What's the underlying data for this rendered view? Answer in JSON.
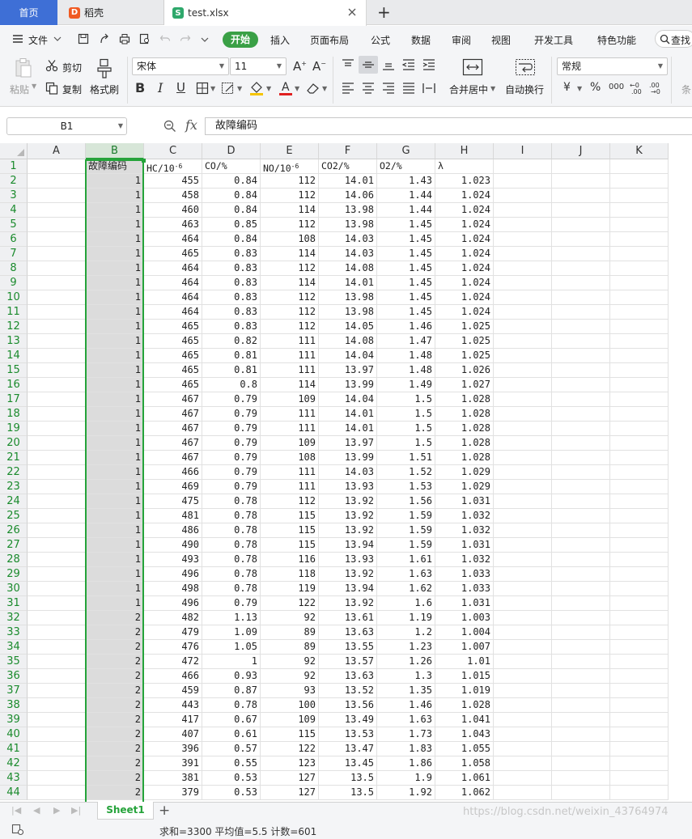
{
  "tabs": {
    "home": "首页",
    "daoke": "稻壳",
    "file": "test.xlsx",
    "add": "+"
  },
  "menu": {
    "file": "文件",
    "start": "开始",
    "insert": "插入",
    "page_layout": "页面布局",
    "formula": "公式",
    "data": "数据",
    "review": "审阅",
    "view": "视图",
    "developer": "开发工具",
    "special": "特色功能",
    "search": "查找"
  },
  "ribbon": {
    "paste": "粘贴",
    "cut": "剪切",
    "copy": "复制",
    "format_painter": "格式刷",
    "font_name": "宋体",
    "font_size": "11",
    "bold": "B",
    "italic": "I",
    "underline": "U",
    "merge_center": "合并居中",
    "wrap_text": "自动换行",
    "number_format": "常规",
    "currency": "¥",
    "percent": "%",
    "thousands": "000",
    "conditional": "条"
  },
  "formula_bar": {
    "name_box": "B1",
    "fx": "fx",
    "content": "故障编码"
  },
  "grid": {
    "columns": [
      "A",
      "B",
      "C",
      "D",
      "E",
      "F",
      "G",
      "H",
      "I",
      "J",
      "K"
    ],
    "selected_column": "B",
    "header_row": {
      "B": "故障编码",
      "C_base": "HC/10",
      "C_exp": "-6",
      "D": "CO/%",
      "E_base": "NO/10",
      "E_exp": "-6",
      "F": "CO2/%",
      "G": "O2/%",
      "H": "λ"
    },
    "rows": [
      [
        1,
        455,
        0.84,
        112,
        14.01,
        1.43,
        1.023
      ],
      [
        1,
        458,
        0.84,
        112,
        14.06,
        1.44,
        1.024
      ],
      [
        1,
        460,
        0.84,
        114,
        13.98,
        1.44,
        1.024
      ],
      [
        1,
        463,
        0.85,
        112,
        13.98,
        1.45,
        1.024
      ],
      [
        1,
        464,
        0.84,
        108,
        14.03,
        1.45,
        1.024
      ],
      [
        1,
        465,
        0.83,
        114,
        14.03,
        1.45,
        1.024
      ],
      [
        1,
        464,
        0.83,
        112,
        14.08,
        1.45,
        1.024
      ],
      [
        1,
        464,
        0.83,
        114,
        14.01,
        1.45,
        1.024
      ],
      [
        1,
        464,
        0.83,
        112,
        13.98,
        1.45,
        1.024
      ],
      [
        1,
        464,
        0.83,
        112,
        13.98,
        1.45,
        1.024
      ],
      [
        1,
        465,
        0.83,
        112,
        14.05,
        1.46,
        1.025
      ],
      [
        1,
        465,
        0.82,
        111,
        14.08,
        1.47,
        1.025
      ],
      [
        1,
        465,
        0.81,
        111,
        14.04,
        1.48,
        1.025
      ],
      [
        1,
        465,
        0.81,
        111,
        13.97,
        1.48,
        1.026
      ],
      [
        1,
        465,
        0.8,
        114,
        13.99,
        1.49,
        1.027
      ],
      [
        1,
        467,
        0.79,
        109,
        14.04,
        1.5,
        1.028
      ],
      [
        1,
        467,
        0.79,
        111,
        14.01,
        1.5,
        1.028
      ],
      [
        1,
        467,
        0.79,
        111,
        14.01,
        1.5,
        1.028
      ],
      [
        1,
        467,
        0.79,
        109,
        13.97,
        1.5,
        1.028
      ],
      [
        1,
        467,
        0.79,
        108,
        13.99,
        1.51,
        1.028
      ],
      [
        1,
        466,
        0.79,
        111,
        14.03,
        1.52,
        1.029
      ],
      [
        1,
        469,
        0.79,
        111,
        13.93,
        1.53,
        1.029
      ],
      [
        1,
        475,
        0.78,
        112,
        13.92,
        1.56,
        1.031
      ],
      [
        1,
        481,
        0.78,
        115,
        13.92,
        1.59,
        1.032
      ],
      [
        1,
        486,
        0.78,
        115,
        13.92,
        1.59,
        1.032
      ],
      [
        1,
        490,
        0.78,
        115,
        13.94,
        1.59,
        1.031
      ],
      [
        1,
        493,
        0.78,
        116,
        13.93,
        1.61,
        1.032
      ],
      [
        1,
        496,
        0.78,
        118,
        13.92,
        1.63,
        1.033
      ],
      [
        1,
        498,
        0.78,
        119,
        13.94,
        1.62,
        1.033
      ],
      [
        1,
        496,
        0.79,
        122,
        13.92,
        1.6,
        1.031
      ],
      [
        2,
        482,
        1.13,
        92,
        13.61,
        1.19,
        1.003
      ],
      [
        2,
        479,
        1.09,
        89,
        13.63,
        1.2,
        1.004
      ],
      [
        2,
        476,
        1.05,
        89,
        13.55,
        1.23,
        1.007
      ],
      [
        2,
        472,
        1,
        92,
        13.57,
        1.26,
        1.01
      ],
      [
        2,
        466,
        0.93,
        92,
        13.63,
        1.3,
        1.015
      ],
      [
        2,
        459,
        0.87,
        93,
        13.52,
        1.35,
        1.019
      ],
      [
        2,
        443,
        0.78,
        100,
        13.56,
        1.46,
        1.028
      ],
      [
        2,
        417,
        0.67,
        109,
        13.49,
        1.63,
        1.041
      ],
      [
        2,
        407,
        0.61,
        115,
        13.53,
        1.73,
        1.043
      ],
      [
        2,
        396,
        0.57,
        122,
        13.47,
        1.83,
        1.055
      ],
      [
        2,
        391,
        0.55,
        123,
        13.45,
        1.86,
        1.058
      ],
      [
        2,
        381,
        0.53,
        127,
        13.5,
        1.9,
        1.061
      ],
      [
        2,
        379,
        0.53,
        127,
        13.5,
        1.92,
        1.062
      ]
    ]
  },
  "sheets": {
    "active": "Sheet1",
    "add": "+"
  },
  "status": {
    "summary": "求和=3300  平均值=5.5  计数=601"
  },
  "watermark": "https://blog.csdn.net/weixin_43764974",
  "colors": {
    "accent_green": "#25a33a",
    "home_tab_blue": "#3e6fd6",
    "daoke_orange": "#f05a22",
    "xlsx_green": "#2ea86b"
  }
}
